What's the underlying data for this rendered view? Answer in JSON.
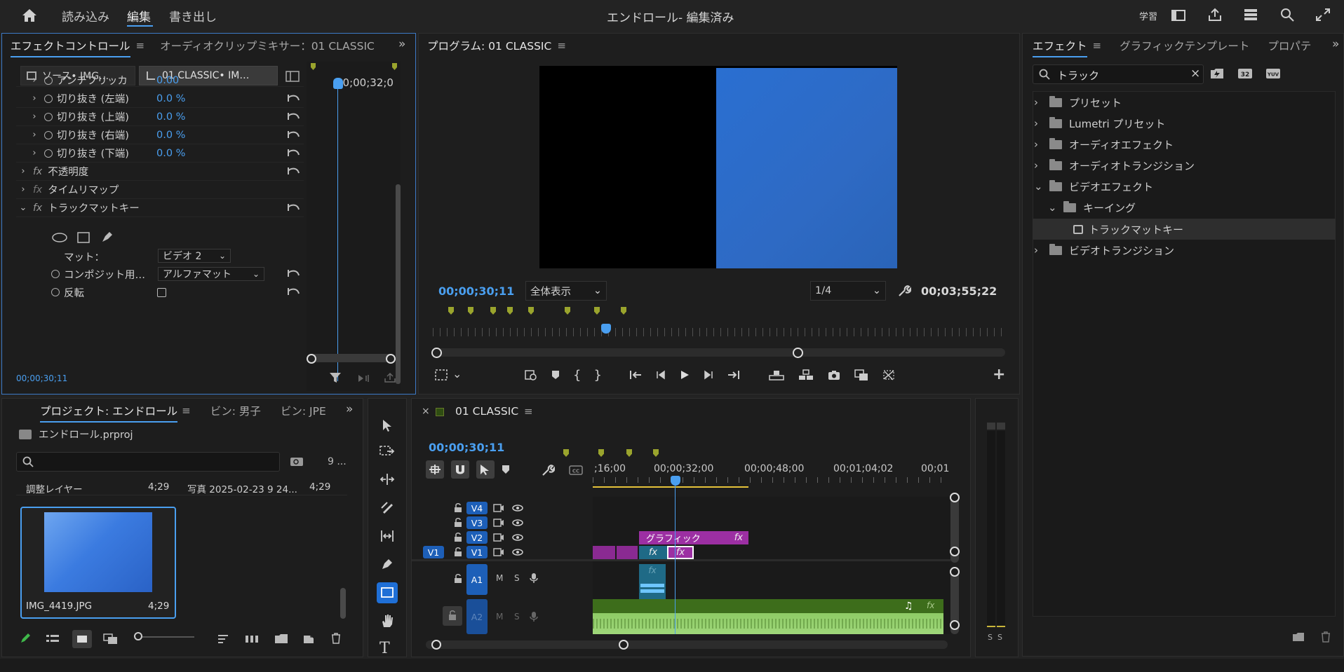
{
  "header": {
    "title": "エンドロール- 編集済み",
    "menu": [
      "読み込み",
      "編集",
      "書き出し"
    ],
    "active_menu": "編集",
    "learn": "学習"
  },
  "effect_controls": {
    "tab_active": "エフェクトコントロール",
    "tab_other": "オーディオクリップミキサー：01 CLASSIC",
    "source_tab": "ソース• IMG…",
    "seq_tab": "01 CLASSIC• IM…",
    "timecode_ruler": "00;00;32;0",
    "rows": [
      {
        "label": "アンチフリッカ",
        "value": "0.00"
      },
      {
        "label": "切り抜き (左端)",
        "value": "0.0 %"
      },
      {
        "label": "切り抜き (上端)",
        "value": "0.0 %"
      },
      {
        "label": "切り抜き (右端)",
        "value": "0.0 %"
      },
      {
        "label": "切り抜き (下端)",
        "value": "0.0 %"
      }
    ],
    "opacity": "不透明度",
    "timeremap": "タイムリマップ",
    "trackmatte": "トラックマットキー",
    "matte_label": "マット：",
    "matte_value": "ビデオ 2",
    "composite_label": "コンポジット用…",
    "composite_value": "アルファマット",
    "reverse_label": "反転",
    "timecode": "00;00;30;11"
  },
  "program": {
    "title": "プログラム: 01 CLASSIC",
    "timecode": "00;00;30;11",
    "fit": "全体表示",
    "resolution": "1/4",
    "duration": "00;03;55;22"
  },
  "effects": {
    "tabs": [
      "エフェクト",
      "グラフィックテンプレート",
      "プロパテ"
    ],
    "search": "トラック",
    "items": [
      {
        "label": "プリセット"
      },
      {
        "label": "Lumetri プリセット"
      },
      {
        "label": "オーディオエフェクト"
      },
      {
        "label": "オーディオトランジション"
      },
      {
        "label": "ビデオエフェクト"
      },
      {
        "label": "キーイング"
      },
      {
        "label": "トラックマットキー"
      },
      {
        "label": "ビデオトランジション"
      }
    ]
  },
  "project": {
    "tab_active": "プロジェクト: エンドロール",
    "tab_bin1": "ビン: 男子",
    "tab_bin2": "ビン: JPE",
    "file": "エンドロール.prproj",
    "count": "9 ...",
    "row1_name": "調整レイヤー",
    "row1_dur": "4;29",
    "row1_name2": "写真 2025-02-23 9 24...",
    "row1_dur2": "4;29",
    "thumb_name": "IMG_4419.JPG",
    "thumb_dur": "4;29"
  },
  "timeline": {
    "title": "01 CLASSIC",
    "timecode": "00;00;30;11",
    "ruler": [
      ";16;00",
      "00;00;32;00",
      "00;00;48;00",
      "00;01;04;02",
      "00;01"
    ],
    "video_tracks": [
      "V4",
      "V3",
      "V2",
      "V1"
    ],
    "audio_tracks": [
      "A1",
      "A2"
    ],
    "src_v1": "V1",
    "mute": "M",
    "solo": "S",
    "clip_graphic": "グラフィック",
    "fx": "fx"
  },
  "meter": {
    "labels": [
      "S",
      "S"
    ]
  },
  "colors": {
    "accent": "#4a9ff0",
    "clip_purple": "#9c2fa3",
    "clip_teal": "#1f6a86",
    "audio_green": "#7cc155",
    "program_blue": "#2a6fd1"
  }
}
